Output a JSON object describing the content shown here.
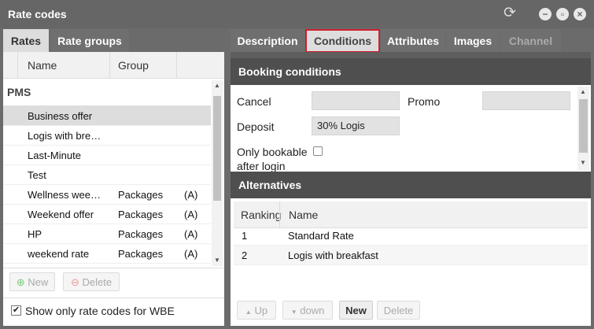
{
  "window": {
    "title": "Rate codes"
  },
  "left_tabs": [
    "Rates",
    "Rate groups"
  ],
  "rates_table": {
    "columns": [
      "Name",
      "Group"
    ],
    "group_label": "PMS",
    "rows": [
      {
        "name": "Business offer",
        "group": "",
        "flag": ""
      },
      {
        "name": "Logis with bre…",
        "group": "",
        "flag": ""
      },
      {
        "name": "Last-Minute",
        "group": "",
        "flag": ""
      },
      {
        "name": "Test",
        "group": "",
        "flag": ""
      },
      {
        "name": "Wellness wee…",
        "group": "Packages",
        "flag": "(A)"
      },
      {
        "name": "Weekend offer",
        "group": "Packages",
        "flag": "(A)"
      },
      {
        "name": "HP",
        "group": "Packages",
        "flag": "(A)"
      },
      {
        "name": "weekend rate",
        "group": "Packages",
        "flag": "(A)"
      }
    ],
    "selected_index": 0
  },
  "left_buttons": {
    "new": "New",
    "delete": "Delete"
  },
  "wbe_filter": {
    "label": "Show only rate codes for WBE",
    "checked": true
  },
  "right_tabs": [
    "Description",
    "Conditions",
    "Attributes",
    "Images",
    "Channel"
  ],
  "booking_conditions": {
    "title": "Booking conditions",
    "cancel_label": "Cancel",
    "cancel_value": "",
    "promo_label": "Promo",
    "promo_value": "",
    "deposit_label": "Deposit",
    "deposit_value": "30% Logis",
    "bookable_label_1": "Only bookable",
    "bookable_label_2": "after login"
  },
  "alternatives": {
    "title": "Alternatives",
    "columns": [
      "Ranking",
      "Name"
    ],
    "rows": [
      {
        "ranking": "1",
        "name": "Standard Rate"
      },
      {
        "ranking": "2",
        "name": "Logis with breakfast"
      }
    ],
    "buttons": {
      "up": "Up",
      "down": "down",
      "new": "New",
      "delete": "Delete"
    }
  }
}
